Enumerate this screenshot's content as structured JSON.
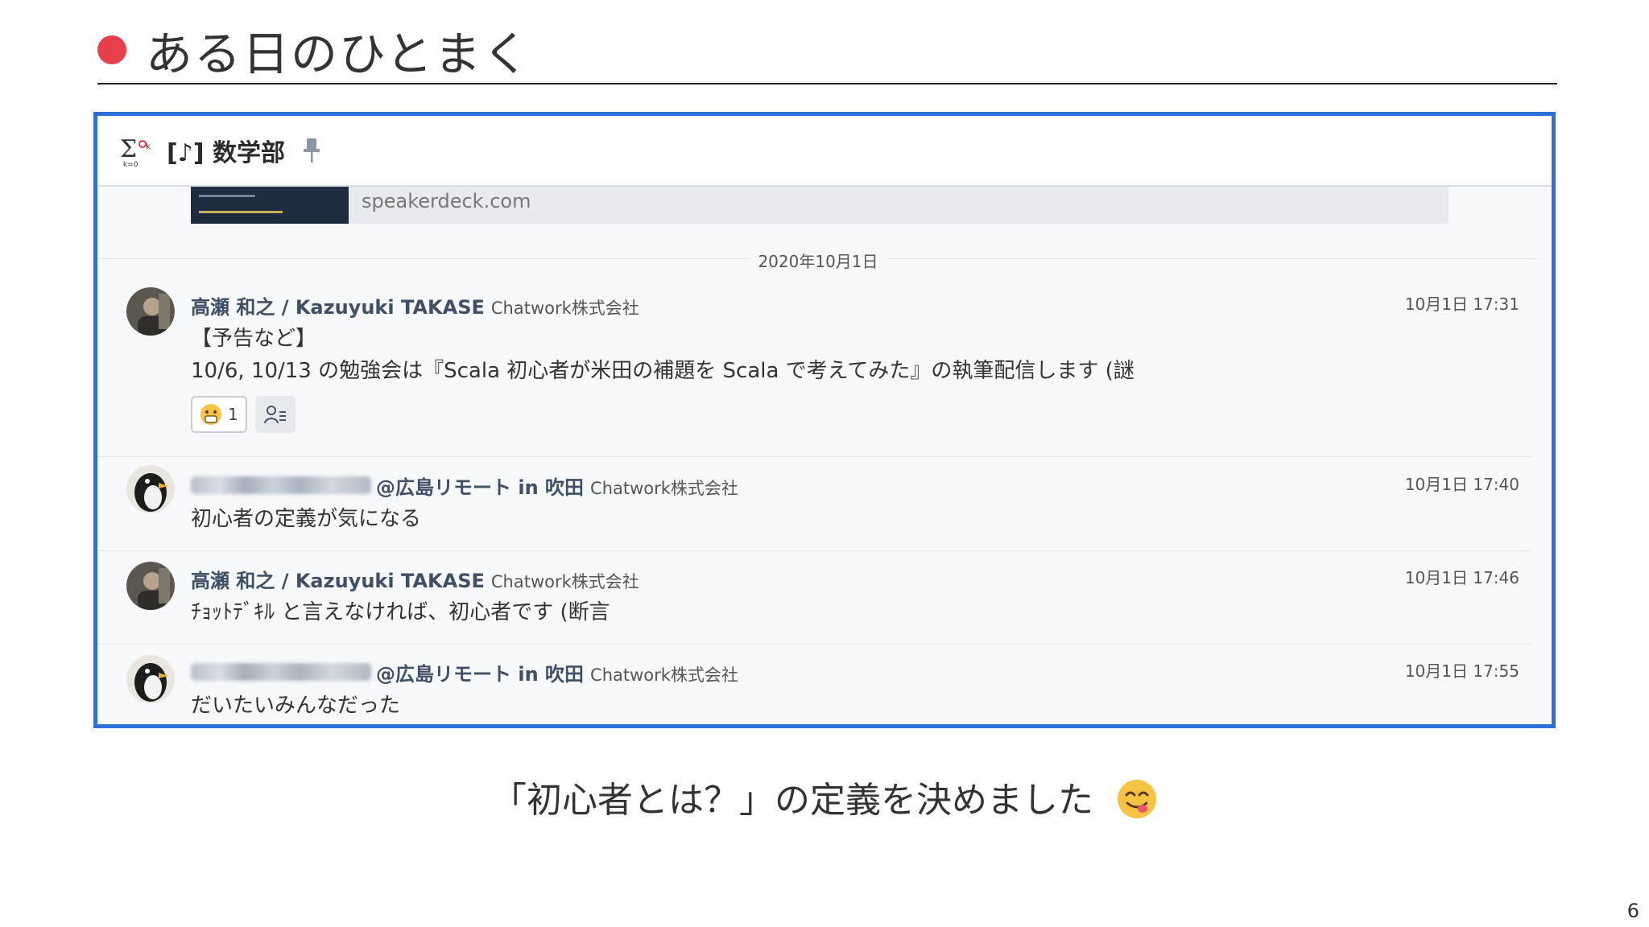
{
  "slide": {
    "title": "ある日のひとまく",
    "caption": "「初心者とは？」の定義を決めました",
    "page_number": "6",
    "accent_color": "#e8404a",
    "frame_color": "#2f6fdc"
  },
  "room": {
    "name": "[♪] 数学部",
    "icon": "sigma-room-icon",
    "pin_icon": "pin-icon"
  },
  "link_preview": {
    "domain": "speakerdeck.com"
  },
  "date_divider": "2020年10月1日",
  "messages": [
    {
      "sender": "高瀬 和之 / Kazuyuki TAKASE",
      "org": "Chatwork株式会社",
      "time": "10月1日 17:31",
      "lines": [
        "【予告など】",
        "10/6,  10/13 の勉強会は『Scala 初心者が米田の補題を Scala で考えてみた』の執筆配信します (謎"
      ],
      "reaction": {
        "icon": "surprised-face-emoji",
        "count": "1"
      }
    },
    {
      "sender_visible": "@広島リモート in 吹田",
      "org": "Chatwork株式会社",
      "time": "10月1日 17:40",
      "lines": [
        "初心者の定義が気になる"
      ]
    },
    {
      "sender": "高瀬 和之 / Kazuyuki TAKASE",
      "org": "Chatwork株式会社",
      "time": "10月1日 17:46",
      "lines": [
        "ﾁｮｯﾄﾃﾞｷﾙ と言えなければ、初心者です (断言"
      ]
    },
    {
      "sender_visible": "@広島リモート in 吹田",
      "org": "Chatwork株式会社",
      "time": "10月1日 17:55",
      "lines": [
        "だいたいみんなだった"
      ]
    }
  ]
}
